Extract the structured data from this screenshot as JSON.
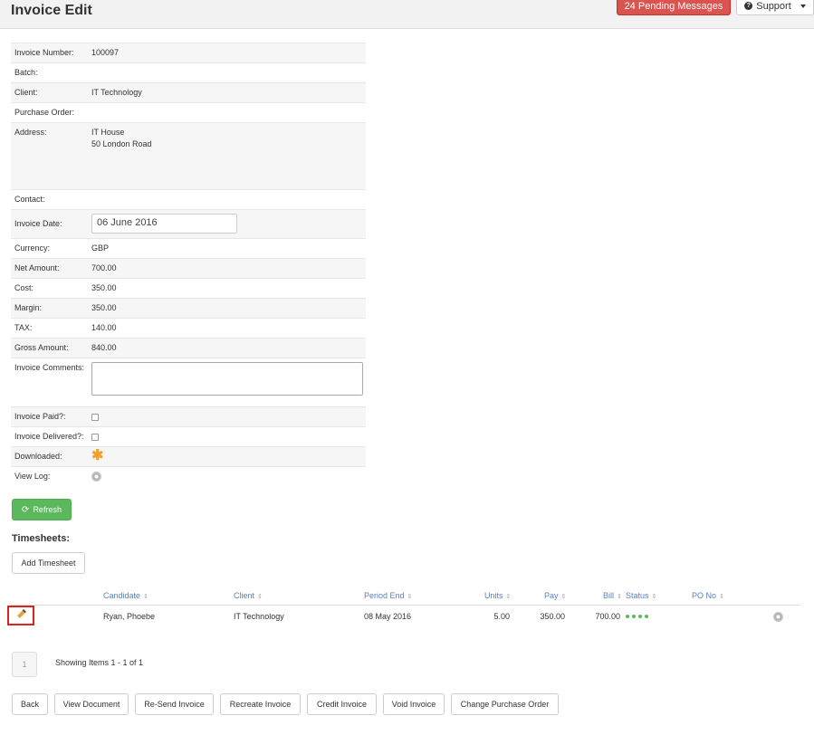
{
  "header": {
    "title": "Invoice Edit",
    "pending_messages": "24 Pending Messages",
    "support": "Support"
  },
  "form": {
    "invoice_number_label": "Invoice Number:",
    "invoice_number": "100097",
    "batch_label": "Batch:",
    "batch": "",
    "client_label": "Client:",
    "client": "IT Technology",
    "po_label": "Purchase Order:",
    "po": "",
    "address_label": "Address:",
    "address_line1": "IT House",
    "address_line2": "50 London Road",
    "contact_label": "Contact:",
    "contact": "",
    "invoice_date_label": "Invoice Date:",
    "invoice_date": "06 June 2016",
    "currency_label": "Currency:",
    "currency": "GBP",
    "net_label": "Net Amount:",
    "net": "700.00",
    "cost_label": "Cost:",
    "cost": "350.00",
    "margin_label": "Margin:",
    "margin": "350.00",
    "tax_label": "TAX:",
    "tax": "140.00",
    "gross_label": "Gross Amount:",
    "gross": "840.00",
    "comments_label": "Invoice Comments:",
    "comments": "",
    "paid_label": "Invoice Paid?:",
    "delivered_label": "Invoice Delivered?:",
    "downloaded_label": "Downloaded:",
    "viewlog_label": "View Log:"
  },
  "refresh_label": "Refresh",
  "timesheets": {
    "title": "Timesheets:",
    "add_label": "Add Timesheet",
    "columns": {
      "candidate": "Candidate",
      "client": "Client",
      "period_end": "Period End",
      "units": "Units",
      "pay": "Pay",
      "bill": "Bill",
      "status": "Status",
      "po_no": "PO No"
    },
    "rows": [
      {
        "candidate": "Ryan, Phoebe",
        "client": "IT Technology",
        "period_end": "08 May 2016",
        "units": "5.00",
        "pay": "350.00",
        "bill": "700.00",
        "po_no": ""
      }
    ],
    "page": "1",
    "showing": "Showing Items 1 - 1 of 1"
  },
  "actions": {
    "back": "Back",
    "view_document": "View Document",
    "resend": "Re-Send Invoice",
    "recreate": "Recreate Invoice",
    "credit": "Credit Invoice",
    "void": "Void Invoice",
    "change_po": "Change Purchase Order"
  },
  "colors": {
    "danger": "#d9534f",
    "success": "#5cb85c",
    "link": "#5a7fbf"
  }
}
